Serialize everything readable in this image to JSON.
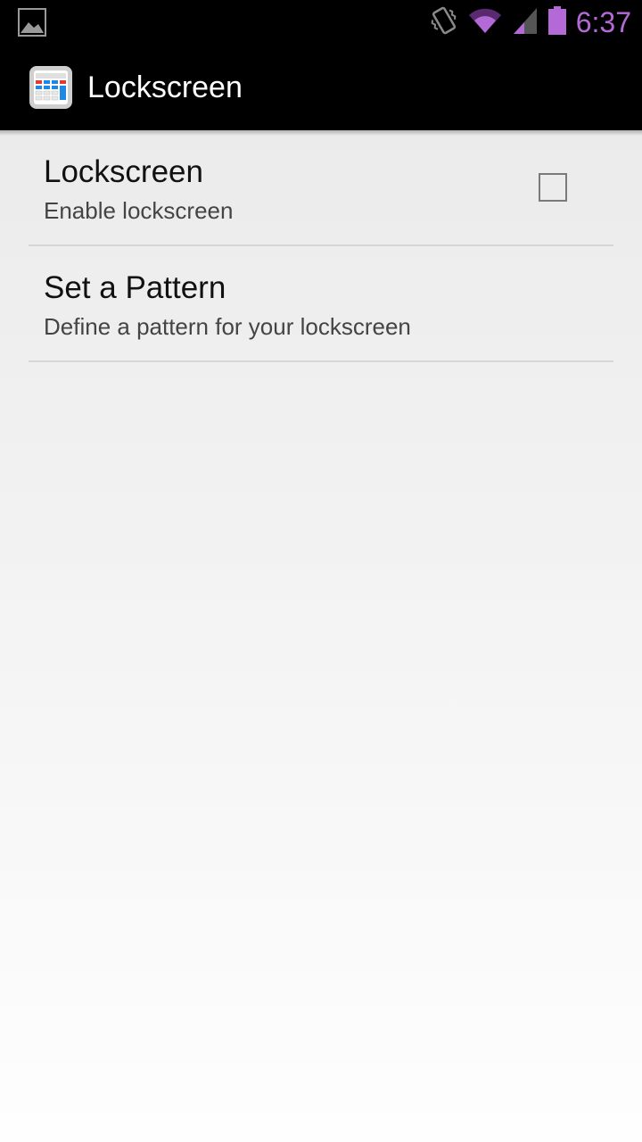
{
  "status_bar": {
    "time": "6:37",
    "left_icon": "image-notification-icon",
    "icons": [
      "vibrate-icon",
      "wifi-icon",
      "signal-icon",
      "battery-icon"
    ],
    "accent_color": "#b36ad6"
  },
  "action_bar": {
    "title": "Lockscreen",
    "app_icon": "calculator-app-icon"
  },
  "preferences": [
    {
      "title": "Lockscreen",
      "summary": "Enable lockscreen",
      "has_checkbox": true,
      "checked": false
    },
    {
      "title": "Set a Pattern",
      "summary": "Define a pattern for your lockscreen",
      "has_checkbox": false
    }
  ]
}
